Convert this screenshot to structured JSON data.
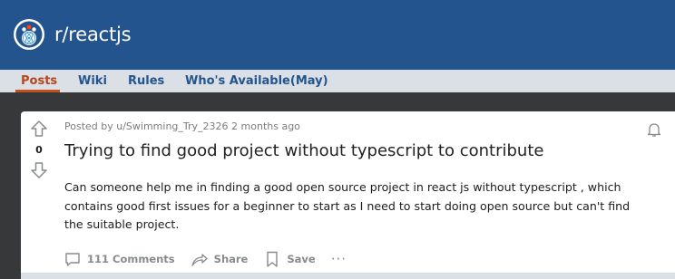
{
  "header": {
    "subreddit_name": "r/reactjs",
    "icon": "reddit-snoo-react-icon",
    "colors": {
      "banner": "#24548e",
      "tab_bar": "#dae0e6",
      "accent": "#c4501a"
    }
  },
  "tabs": [
    {
      "label": "Posts",
      "active": true
    },
    {
      "label": "Wiki",
      "active": false
    },
    {
      "label": "Rules",
      "active": false
    },
    {
      "label": "Who's Available(May)",
      "active": false
    }
  ],
  "post": {
    "score": "0",
    "meta": "Posted by u/Swimming_Try_2326 2 months ago",
    "title": "Trying to find good project without typescript to contribute",
    "body": "Can someone help me in finding a good open source project in react js without typescript , which contains good first issues for a beginner to start as I need to start doing open source but can't find the suitable project.",
    "actions": {
      "comments": "111 Comments",
      "share": "Share",
      "save": "Save",
      "more": "···"
    }
  }
}
